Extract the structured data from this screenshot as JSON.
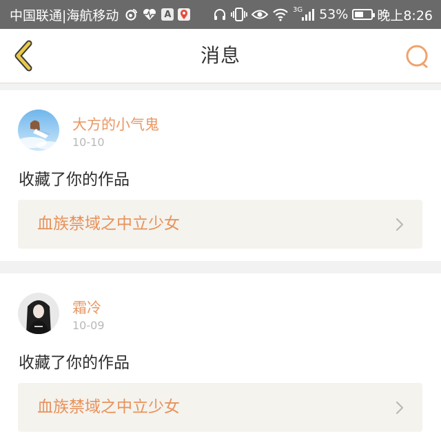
{
  "status_bar": {
    "carrier": "中国联通|海航移动",
    "left_icons": [
      "weibo-icon",
      "heart-pulse-icon",
      "a-box-icon",
      "map-pin-icon"
    ],
    "a_box_label": "A",
    "right_icons": [
      "headphone-icon",
      "vibrate-icon",
      "eye-icon",
      "wifi-icon",
      "signal-icon",
      "battery-icon"
    ],
    "network_type": "3G",
    "battery_percent": "53%",
    "battery_level": 0.53,
    "time": "晚上8:26"
  },
  "header": {
    "title": "消息",
    "back_icon": "chevron-left-icon",
    "search_icon": "search-icon",
    "accent": "#e9a84a"
  },
  "messages": [
    {
      "username": "大方的小气鬼",
      "date": "10-10",
      "action": "收藏了你的作品",
      "work_title": "血族禁域之中立少女"
    },
    {
      "username": "霜冷",
      "date": "10-09",
      "action": "收藏了你的作品",
      "work_title": "血族禁域之中立少女"
    }
  ],
  "colors": {
    "username": "#e99762",
    "work_title": "#e9915a",
    "status_bar_bg": "#6a6a6a",
    "work_bg": "#f4f3ee"
  }
}
